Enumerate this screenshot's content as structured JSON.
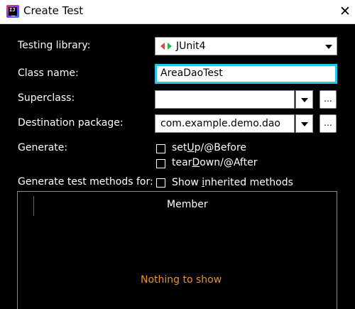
{
  "window": {
    "title": "Create Test",
    "app_icon_text": "IJ"
  },
  "form": {
    "testing_library": {
      "label": "Testing library:",
      "value": "JUnit4"
    },
    "class_name": {
      "label": "Class name:",
      "value": "AreaDaoTest"
    },
    "superclass": {
      "label": "Superclass:",
      "value": "",
      "browse_label": "..."
    },
    "destination_package": {
      "label": "Destination package:",
      "value": "com.example.demo.dao",
      "browse_label": "..."
    },
    "generate": {
      "label": "Generate:",
      "setup": {
        "pre": "set",
        "mnemonic": "U",
        "post": "p/@Before",
        "checked": false
      },
      "teardown": {
        "pre": "tear",
        "mnemonic": "D",
        "post": "own/@After",
        "checked": false
      }
    },
    "methods": {
      "label": "Generate test methods for:",
      "show_inherited": {
        "pre": "Show ",
        "mnemonic": "i",
        "post": "nherited methods",
        "checked": false
      }
    }
  },
  "table": {
    "column_header": "Member",
    "empty_text": "Nothing to show"
  },
  "colors": {
    "focus_border": "#25c7e6",
    "empty_text": "#e8912d",
    "junit_red": "#e2413b",
    "junit_green": "#2fb34a"
  }
}
